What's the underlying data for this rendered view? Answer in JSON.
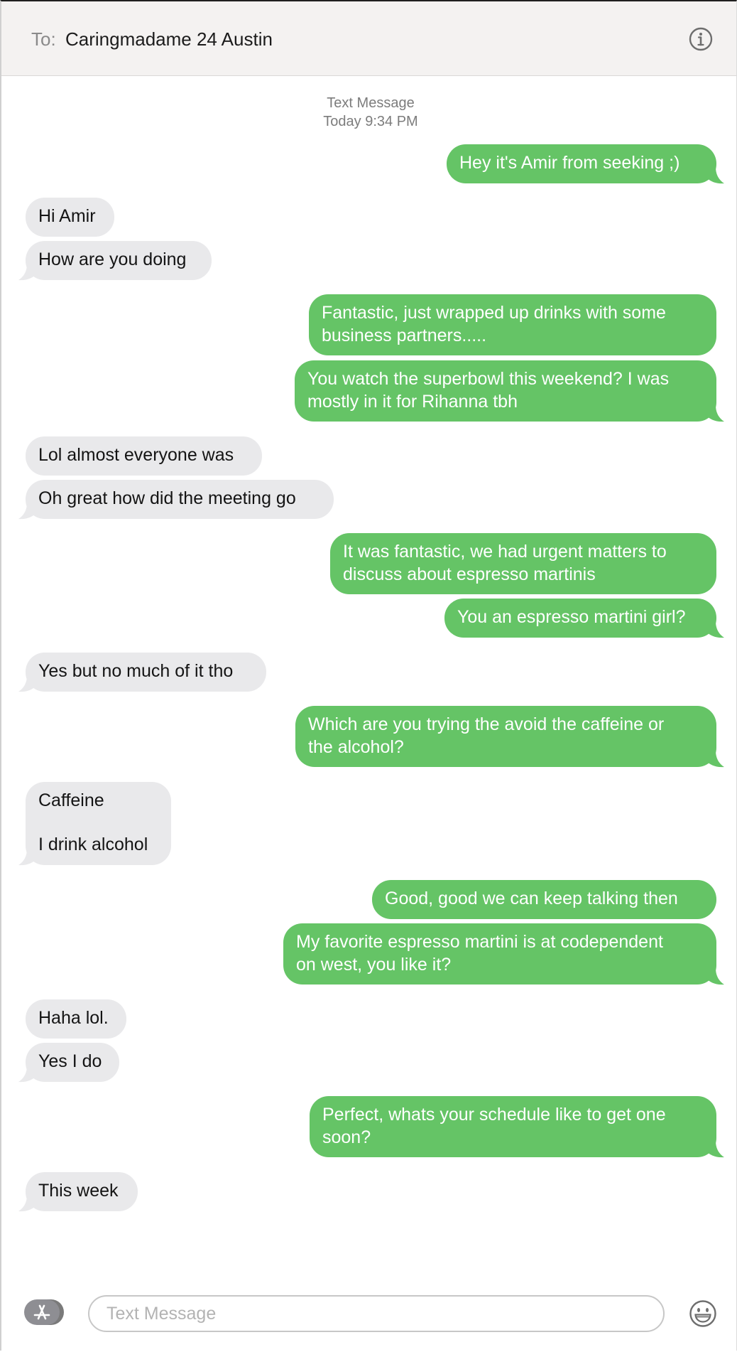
{
  "header": {
    "to_label": "To:",
    "recipient": "Caringmadame 24 Austin",
    "info_icon": "info-icon"
  },
  "timestamp": {
    "kind": "Text Message",
    "time": "Today 9:34 PM"
  },
  "messages": [
    {
      "from": "me",
      "text": "Hey it's Amir from seeking ;)"
    },
    {
      "from": "them",
      "text": "Hi Amir"
    },
    {
      "from": "them",
      "text": "How are you doing"
    },
    {
      "from": "me",
      "text": "Fantastic, just wrapped up drinks with some\nbusiness partners....."
    },
    {
      "from": "me",
      "text": "You watch the superbowl this weekend? I was\nmostly in it for Rihanna tbh"
    },
    {
      "from": "them",
      "text": "Lol almost everyone was"
    },
    {
      "from": "them",
      "text": "Oh great how did the meeting go"
    },
    {
      "from": "me",
      "text": "It was fantastic, we had urgent matters to\ndiscuss about espresso martinis"
    },
    {
      "from": "me",
      "text": "You an espresso martini girl?"
    },
    {
      "from": "them",
      "text": "Yes but no much of it tho"
    },
    {
      "from": "me",
      "text": "Which are you trying the avoid the caffeine or\nthe alcohol?"
    },
    {
      "from": "them",
      "text": "Caffeine\n\nI drink alcohol"
    },
    {
      "from": "me",
      "text": "Good, good we can keep talking then"
    },
    {
      "from": "me",
      "text": "My favorite espresso martini is at codependent\non west, you like it?"
    },
    {
      "from": "them",
      "text": "Haha lol."
    },
    {
      "from": "them",
      "text": "Yes I do"
    },
    {
      "from": "me",
      "text": "Perfect, whats your schedule like to get one\nsoon?"
    },
    {
      "from": "them",
      "text": "This week"
    }
  ],
  "composer": {
    "placeholder": "Text Message",
    "apps_icon": "app-store-icon",
    "emoji_icon": "emoji-icon"
  },
  "colors": {
    "sent_bubble": "#65c466",
    "received_bubble": "#e9e9eb",
    "header_bg": "#f4f2f1"
  }
}
